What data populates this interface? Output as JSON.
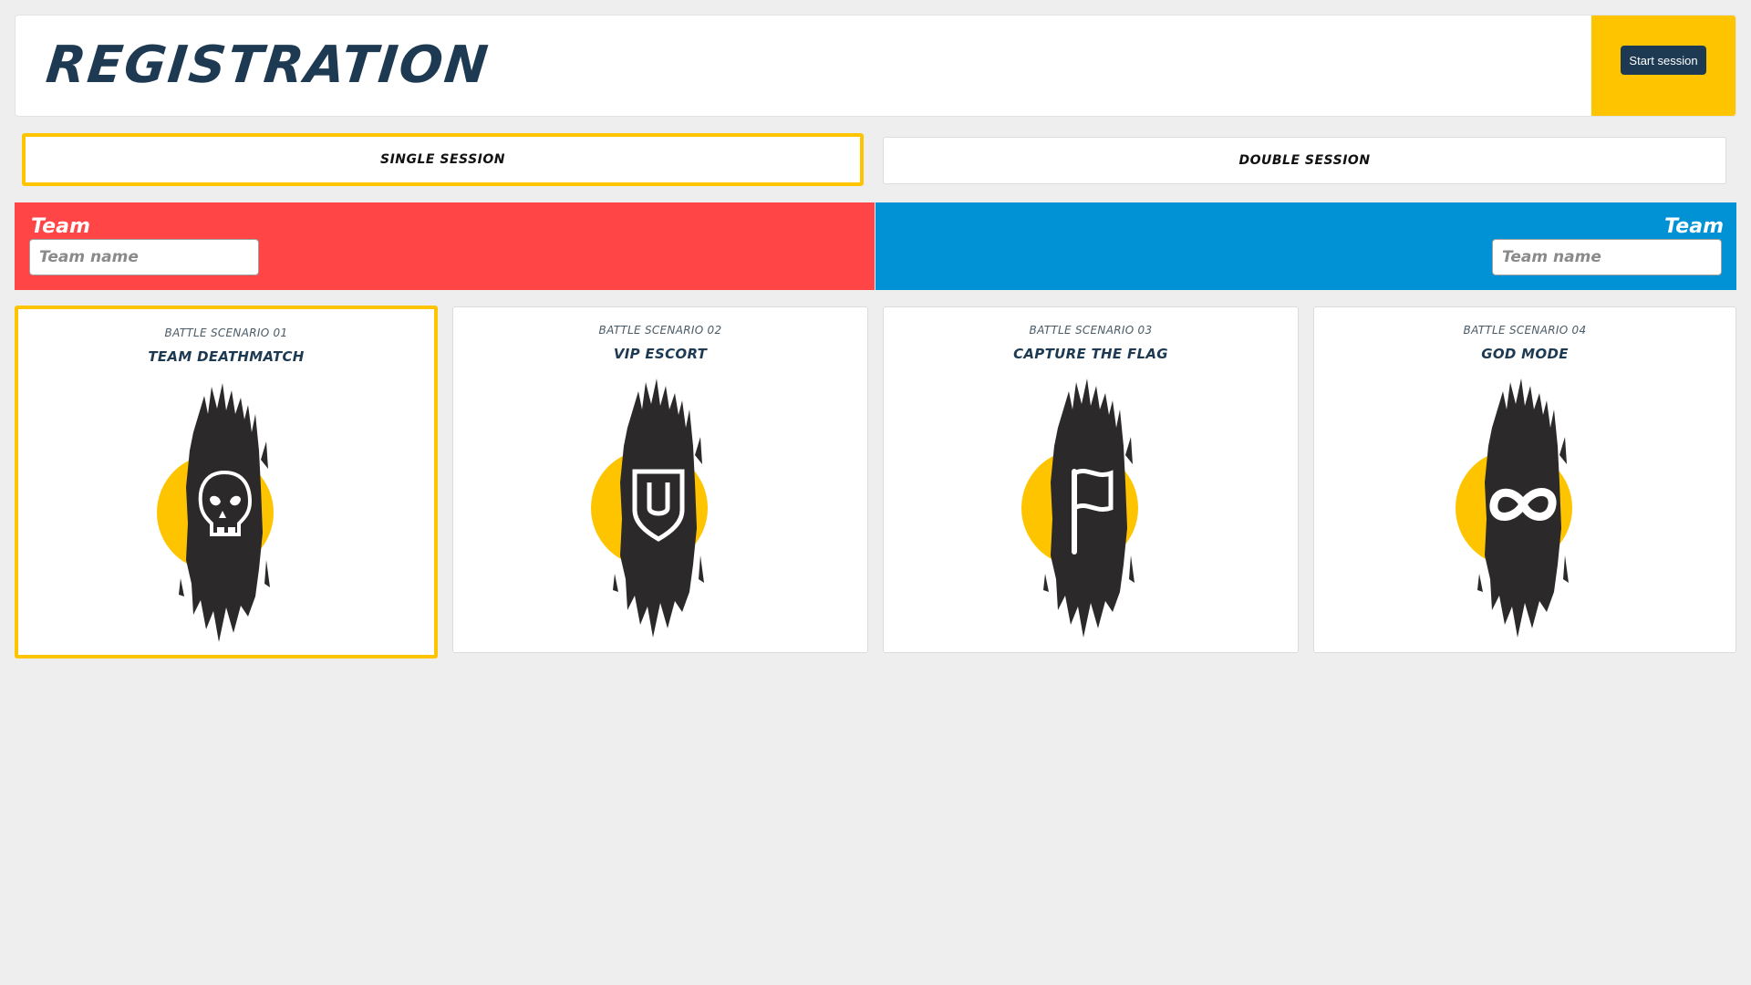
{
  "header": {
    "title": "REGISTRATION",
    "start_button_label": "Start session"
  },
  "sessions": [
    {
      "label": "SINGLE SESSION",
      "active": true
    },
    {
      "label": "DOUBLE SESSION",
      "active": false
    }
  ],
  "teams": {
    "red": {
      "label": "Team",
      "placeholder": "Team name",
      "value": ""
    },
    "blue": {
      "label": "Team",
      "placeholder": "Team name",
      "value": ""
    }
  },
  "scenarios": [
    {
      "subtitle": "BATTLE SCENARIO 01",
      "title": "TEAM DEATHMATCH",
      "icon": "skull-icon",
      "active": true
    },
    {
      "subtitle": "BATTLE SCENARIO 02",
      "title": "VIP ESCORT",
      "icon": "shield-icon",
      "active": false
    },
    {
      "subtitle": "BATTLE SCENARIO 03",
      "title": "CAPTURE THE FLAG",
      "icon": "flag-icon",
      "active": false
    },
    {
      "subtitle": "BATTLE SCENARIO 04",
      "title": "GOD MODE",
      "icon": "infinity-icon",
      "active": false
    }
  ],
  "colors": {
    "accent": "#ffc400",
    "navy": "#1d3a52",
    "team_red": "#ff4545",
    "team_blue": "#0092d4",
    "background": "#eeeeee"
  }
}
